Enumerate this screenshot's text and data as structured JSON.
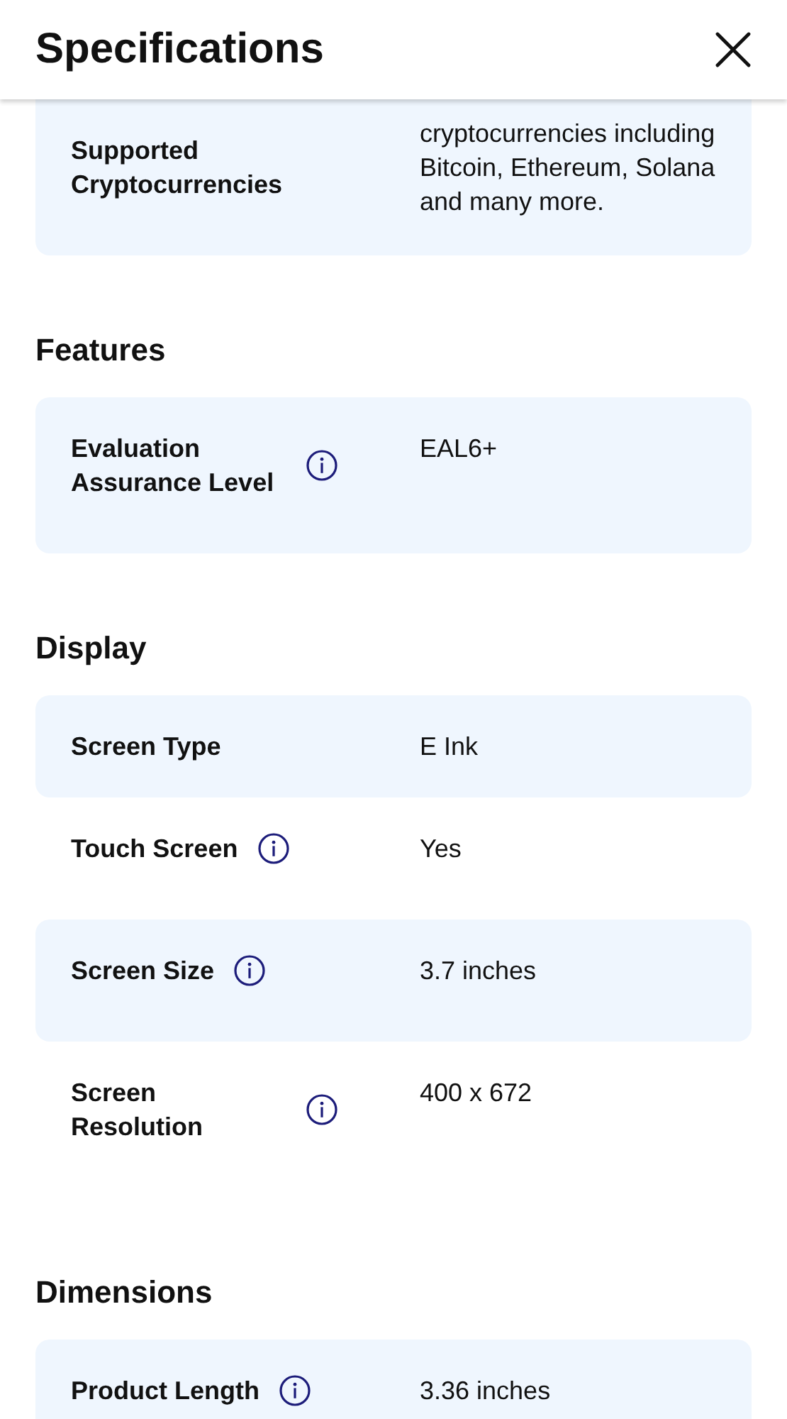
{
  "header": {
    "title": "Specifications"
  },
  "sections": [
    {
      "rows": [
        {
          "label": "Supported Cryptocurrencies",
          "info": false,
          "value": "cryptocurrencies including Bitcoin, Ethereum, Solana and many more."
        }
      ]
    },
    {
      "heading": "Features",
      "rows": [
        {
          "label": "Evaluation Assurance Level",
          "info": true,
          "value": "EAL6+"
        }
      ]
    },
    {
      "heading": "Display",
      "rows": [
        {
          "label": "Screen Type",
          "info": false,
          "value": "E Ink"
        },
        {
          "label": "Touch Screen",
          "info": true,
          "value": "Yes"
        },
        {
          "label": "Screen Size",
          "info": true,
          "value": "3.7 inches"
        },
        {
          "label": "Screen Resolution",
          "info": true,
          "value": "400 x 672"
        }
      ]
    },
    {
      "heading": "Dimensions",
      "rows": [
        {
          "label": "Product Length",
          "info": true,
          "value": "3.36 inches"
        }
      ]
    }
  ]
}
